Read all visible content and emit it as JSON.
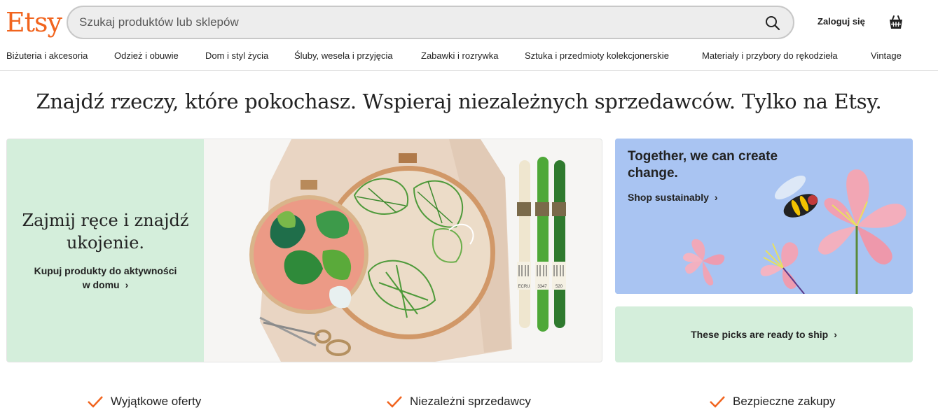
{
  "header": {
    "logo": "Etsy",
    "search_placeholder": "Szukaj produktów lub sklepów",
    "signin_label": "Zaloguj się"
  },
  "categories": [
    "Biżuteria i akcesoria",
    "Odzież i obuwie",
    "Dom i styl życia",
    "Śluby, wesela i przyjęcia",
    "Zabawki i rozrywka",
    "Sztuka i przedmioty kolekcjonerskie",
    "Materiały i przybory do rękodzieła",
    "Vintage"
  ],
  "headline": "Znajdź rzeczy, które pokochasz. Wspieraj niezależnych sprzedawców. Tylko na Etsy.",
  "hero": {
    "title_line1": "Zajmij ręce i znajdź",
    "title_line2": "ukojenie.",
    "link_line1": "Kupuj produkty do aktywności",
    "link_line2": "w domu",
    "thread_labels": [
      "ECRU",
      "3347",
      "520"
    ]
  },
  "sustainable": {
    "title": "Together, we can create change.",
    "link": "Shop sustainably"
  },
  "ready": {
    "label": "These picks are ready to ship"
  },
  "value_props": [
    "Wyjątkowe oferty",
    "Niezależni sprzedawcy",
    "Bezpieczne zakupy"
  ],
  "colors": {
    "brand": "#F1641E",
    "mint": "#D4EEDB",
    "sky": "#A9C4F2"
  }
}
